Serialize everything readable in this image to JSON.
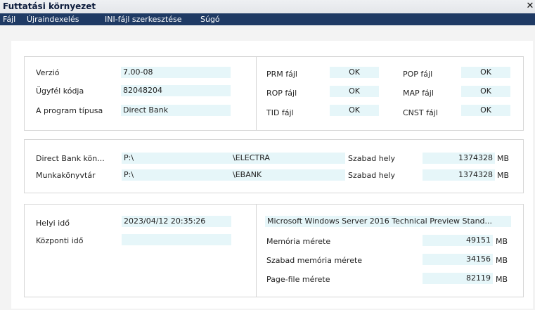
{
  "window": {
    "title": "Futtatási környezet",
    "close_glyph": "✕"
  },
  "menu": [
    "Fájl",
    "Újraindexelés",
    "INI-fájl szerkesztése",
    "Súgó"
  ],
  "program": {
    "version_label": "Verzió",
    "version_value": "7.00-08",
    "client_label": "Ügyfél kódja",
    "client_value": "82048204",
    "type_label": "A program típusa",
    "type_value": "Direct Bank"
  },
  "files": {
    "prm_label": "PRM fájl",
    "prm_value": "OK",
    "rop_label": "ROP fájl",
    "rop_value": "OK",
    "tid_label": "TID fájl",
    "tid_value": "OK",
    "pop_label": "POP fájl",
    "pop_value": "OK",
    "map_label": "MAP fájl",
    "map_value": "OK",
    "cnst_label": "CNST fájl",
    "cnst_value": "OK"
  },
  "dirs": {
    "db_label": "Direct Bank kön...",
    "db_drive": "P:\\",
    "db_path": "\\ELECTRA",
    "db_free_label": "Szabad hely",
    "db_free_value": "1374328",
    "db_free_unit": "MB",
    "work_label": "Munkakönyvtár",
    "work_drive": "P:\\",
    "work_path": "\\EBANK",
    "work_free_label": "Szabad hely",
    "work_free_value": "1374328",
    "work_free_unit": "MB"
  },
  "time": {
    "local_label": "Helyi idő",
    "local_value": "2023/04/12 20:35:26",
    "central_label": "Központi idő",
    "central_value": ""
  },
  "system": {
    "os_value": "Microsoft Windows Server 2016 Technical Preview Stand...",
    "mem_label": "Memória mérete",
    "mem_value": "49151",
    "mem_unit": "MB",
    "freemem_label": "Szabad memória mérete",
    "freemem_value": "34156",
    "freemem_unit": "MB",
    "page_label": "Page-file mérete",
    "page_value": "82119",
    "page_unit": "MB"
  }
}
